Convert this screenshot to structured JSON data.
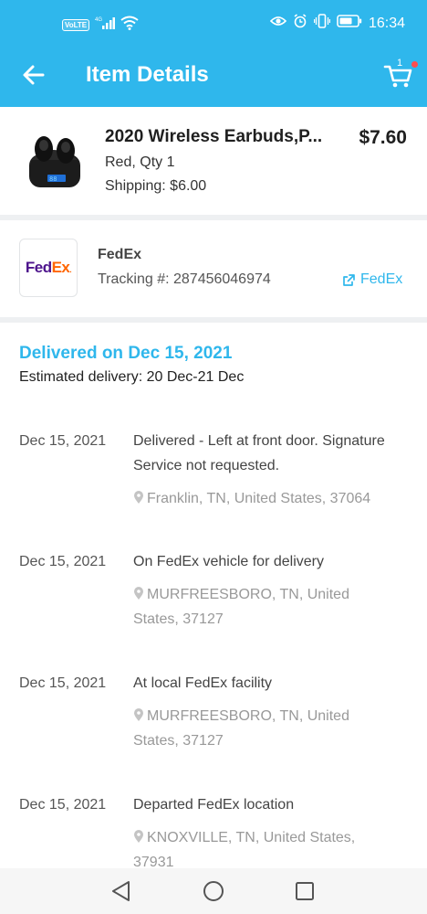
{
  "status_bar": {
    "network_badge": "VoLTE",
    "network_type": "4G",
    "time": "16:34",
    "icons": [
      "signal-icon",
      "wifi-icon",
      "eye-icon",
      "alarm-icon",
      "vibrate-icon",
      "battery-icon"
    ]
  },
  "header": {
    "title": "Item Details",
    "cart_count": "1",
    "accent_color": "#2fb7ec"
  },
  "product": {
    "name": "2020 Wireless Earbuds,P...",
    "price": "$7.60",
    "variant": "Red, Qty 1",
    "shipping": "Shipping: $6.00"
  },
  "carrier": {
    "logo_text_fed": "Fed",
    "logo_text_ex": "Ex",
    "name": "FedEx",
    "tracking": "Tracking #: 287456046974",
    "link_label": "FedEx"
  },
  "delivery": {
    "status": "Delivered on Dec 15, 2021",
    "estimated": "Estimated delivery: 20 Dec-21 Dec"
  },
  "events": [
    {
      "date": "Dec 15, 2021",
      "description": "Delivered - Left at front door. Signature Service not requested.",
      "location": "Franklin, TN, United States, 37064"
    },
    {
      "date": "Dec 15, 2021",
      "description": "On FedEx vehicle for delivery",
      "location": "MURFREESBORO, TN, United States, 37127"
    },
    {
      "date": "Dec 15, 2021",
      "description": "At local FedEx facility",
      "location": "MURFREESBORO, TN, United States, 37127"
    },
    {
      "date": "Dec 15, 2021",
      "description": "Departed FedEx location",
      "location": "KNOXVILLE, TN, United States, 37931"
    }
  ]
}
